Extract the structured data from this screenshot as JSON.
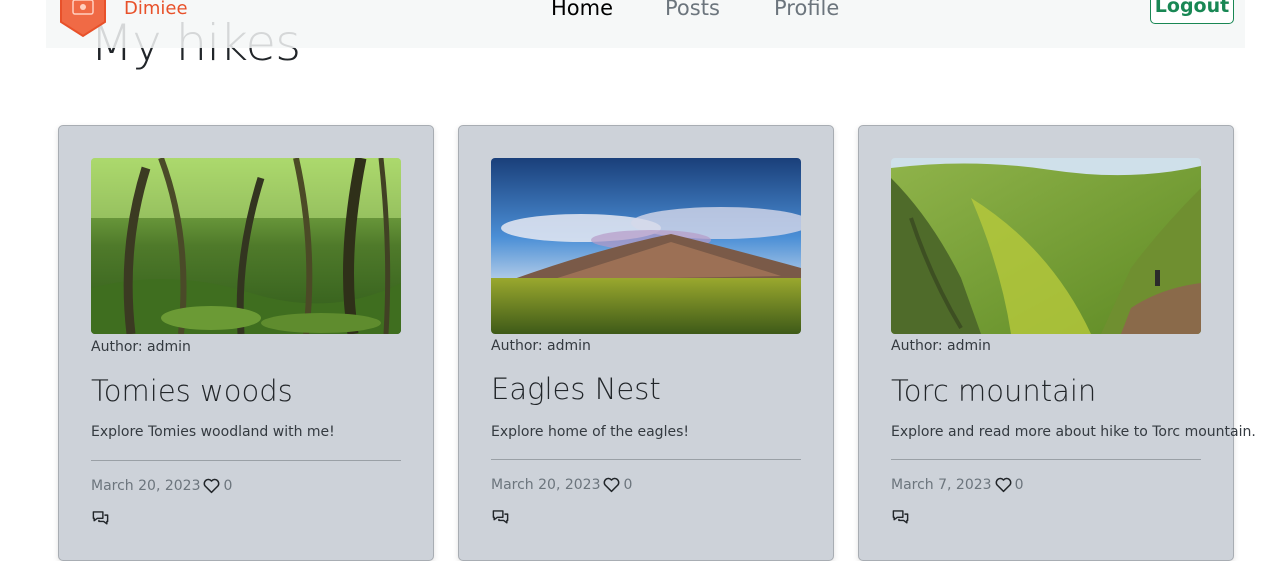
{
  "navbar": {
    "brand": "Dimiee",
    "links": [
      {
        "label": "Home",
        "active": true
      },
      {
        "label": "Posts",
        "active": false
      },
      {
        "label": "Profile",
        "active": false
      }
    ],
    "logout_label": "Logout"
  },
  "page": {
    "title": "My hikes"
  },
  "posts": [
    {
      "author": "Author: admin",
      "title": "Tomies woods",
      "excerpt": "Explore Tomies woodland with me!",
      "date": "March 20, 2023",
      "likes": "0",
      "image_icon": "forest-image"
    },
    {
      "author": "Author: admin",
      "title": "Eagles Nest",
      "excerpt": "Explore home of the eagles!",
      "date": "March 20, 2023",
      "likes": "0",
      "image_icon": "mountain-image"
    },
    {
      "author": "Author: admin",
      "title": "Torc mountain",
      "excerpt": "Explore and read more about hike to Torc mountain.",
      "date": "March 7, 2023",
      "likes": "0",
      "image_icon": "valley-image"
    }
  ],
  "colors": {
    "brand": "#e8512a",
    "logout": "#198754",
    "card_bg": "#cdd2d9"
  }
}
